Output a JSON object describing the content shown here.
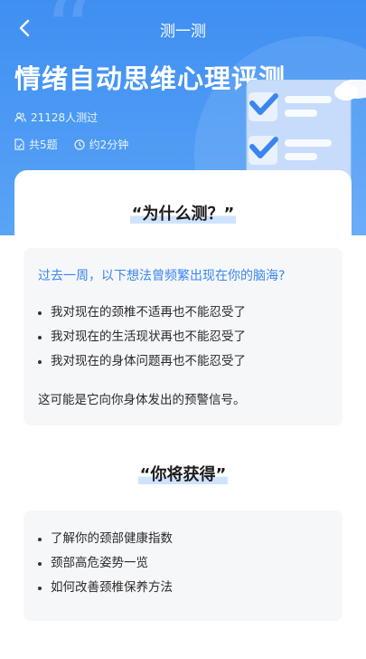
{
  "nav": {
    "title": "测一测"
  },
  "hero": {
    "title": "情绪自动思维心理评测",
    "participants": "21128人测过",
    "questions": "共5题",
    "duration": "约2分钟"
  },
  "why": {
    "heading": "“为什么测？”",
    "question": "过去一周，以下想法曾频繁出现在你的脑海?",
    "items": [
      "我对现在的颈椎不适再也不能忍受了",
      "我对现在的生活现状再也不能忍受了",
      "我对现在的身体问题再也不能忍受了"
    ],
    "note": "这可能是它向你身体发出的预警信号。"
  },
  "gain": {
    "heading": "“你将获得”",
    "items": [
      "了解你的颈部健康指数",
      "颈部高危姿势一览",
      "如何改善颈椎保养方法"
    ]
  },
  "colors": {
    "hero_top": "#3f8ff2",
    "accent": "#3a86f0",
    "highlight": "#cfe3ff"
  }
}
